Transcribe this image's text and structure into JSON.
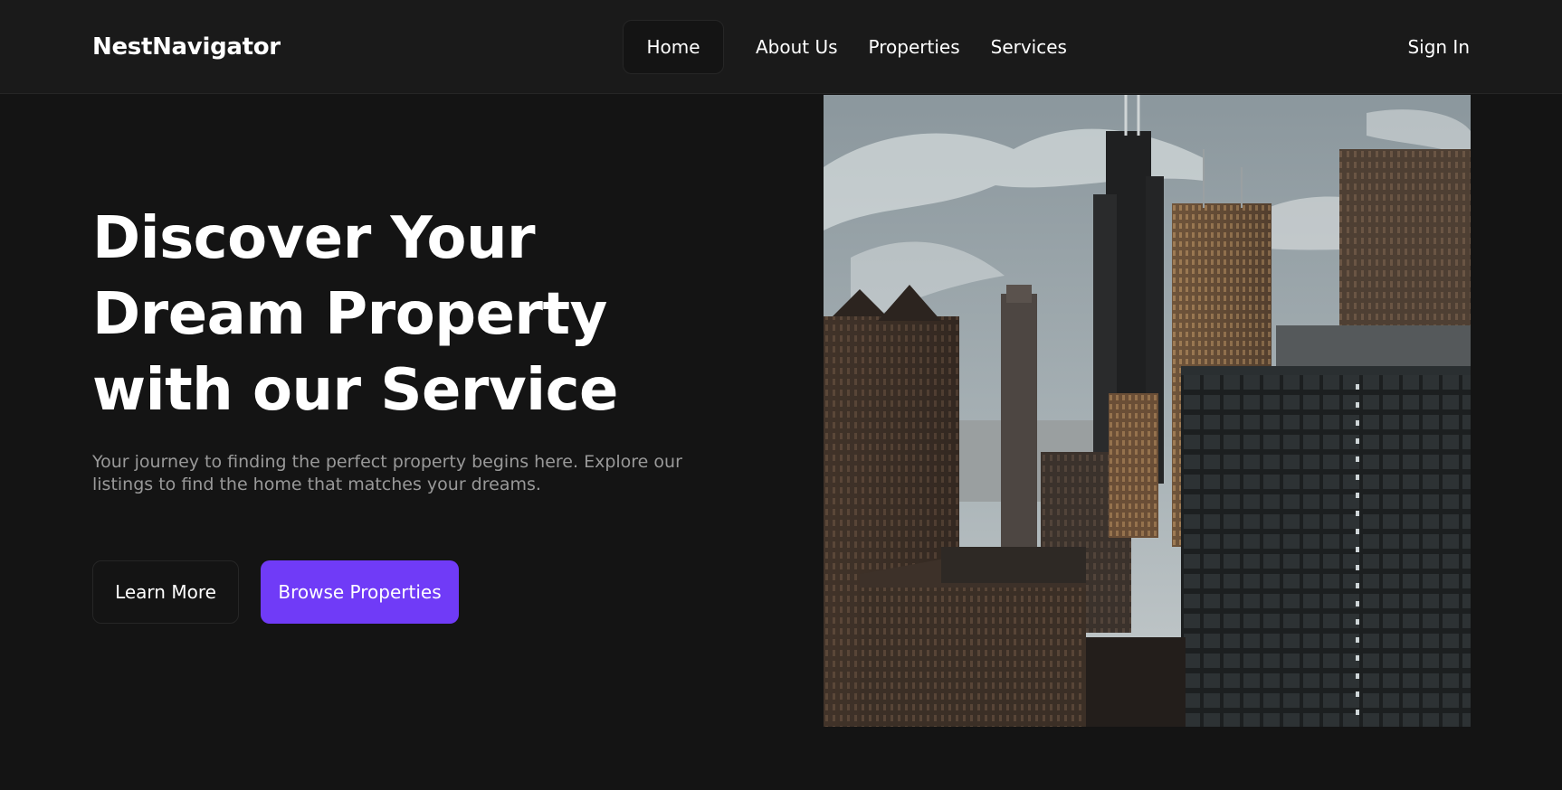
{
  "brand": {
    "name": "NestNavigator"
  },
  "nav": {
    "items": [
      {
        "label": "Home",
        "active": true
      },
      {
        "label": "About Us"
      },
      {
        "label": "Properties"
      },
      {
        "label": "Services"
      }
    ],
    "sign_in": "Sign In"
  },
  "hero": {
    "title": "Discover Your Dream Property with our Service",
    "description": "Your journey to finding the perfect property begins here. Explore our listings to find the home that matches your dreams.",
    "buttons": {
      "learn_more": "Learn More",
      "browse": "Browse Properties"
    },
    "image": {
      "subject": "city-skyline-photo"
    }
  },
  "colors": {
    "background": "#141414",
    "header_background": "#1a1a1a",
    "border": "#262626",
    "accent": "#703bf7",
    "muted_text": "#999999"
  }
}
